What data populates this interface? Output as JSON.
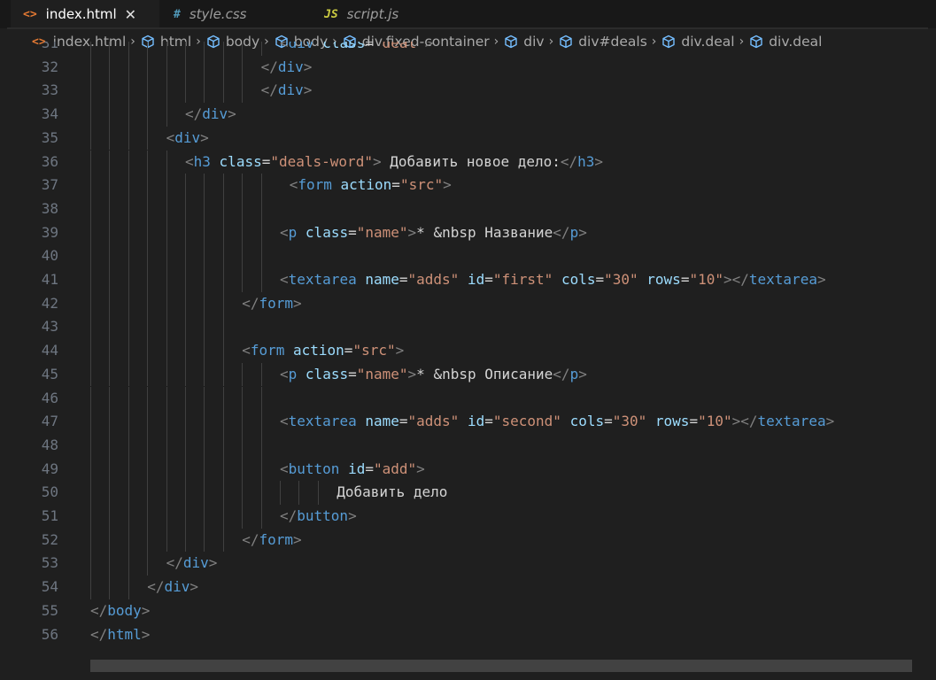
{
  "tabs": [
    {
      "label": "index.html",
      "icon": "<>",
      "active": true
    },
    {
      "label": "style.css",
      "icon": "#",
      "active": false
    },
    {
      "label": "script.js",
      "icon": "JS",
      "active": false
    }
  ],
  "breadcrumb": [
    {
      "label": "index.html",
      "kind": "file"
    },
    {
      "label": "html",
      "kind": "element"
    },
    {
      "label": "body",
      "kind": "element"
    },
    {
      "label": "body",
      "kind": "element"
    },
    {
      "label": "div.fixed-container",
      "kind": "element"
    },
    {
      "label": "div",
      "kind": "element"
    },
    {
      "label": "div#deals",
      "kind": "element"
    },
    {
      "label": "div.deal",
      "kind": "element"
    },
    {
      "label": "div.deal",
      "kind": "element"
    }
  ],
  "code_lines": [
    {
      "n": "31",
      "indent": 10,
      "tokens": [
        [
          "br",
          "<"
        ],
        [
          "tag",
          "div"
        ],
        [
          "text",
          " "
        ],
        [
          "attr",
          "class"
        ],
        [
          "text",
          "="
        ],
        [
          "val",
          "\"deal\""
        ],
        [
          "br",
          ">"
        ]
      ]
    },
    {
      "n": "32",
      "indent": 9,
      "tokens": [
        [
          "br",
          "</"
        ],
        [
          "tag",
          "div"
        ],
        [
          "br",
          ">"
        ]
      ]
    },
    {
      "n": "33",
      "indent": 9,
      "tokens": [
        [
          "br",
          "</"
        ],
        [
          "tag",
          "div"
        ],
        [
          "br",
          ">"
        ]
      ]
    },
    {
      "n": "34",
      "indent": 5,
      "tokens": [
        [
          "br",
          "</"
        ],
        [
          "tag",
          "div"
        ],
        [
          "br",
          ">"
        ]
      ]
    },
    {
      "n": "35",
      "indent": 4,
      "tokens": [
        [
          "br",
          "<"
        ],
        [
          "tag",
          "div"
        ],
        [
          "br",
          ">"
        ]
      ]
    },
    {
      "n": "36",
      "indent": 5,
      "tokens": [
        [
          "br",
          "<"
        ],
        [
          "tag",
          "h3"
        ],
        [
          "text",
          " "
        ],
        [
          "attr",
          "class"
        ],
        [
          "text",
          "="
        ],
        [
          "val",
          "\"deals-word\""
        ],
        [
          "br",
          ">"
        ],
        [
          "text",
          " Добавить новое дело:"
        ],
        [
          "br",
          "</"
        ],
        [
          "tag",
          "h3"
        ],
        [
          "br",
          ">"
        ]
      ]
    },
    {
      "n": "37",
      "indent": 10.5,
      "tokens": [
        [
          "br",
          "<"
        ],
        [
          "tag",
          "form"
        ],
        [
          "text",
          " "
        ],
        [
          "attr",
          "action"
        ],
        [
          "text",
          "="
        ],
        [
          "val",
          "\"src\""
        ],
        [
          "br",
          ">"
        ]
      ]
    },
    {
      "n": "38",
      "indent": 10,
      "tokens": []
    },
    {
      "n": "39",
      "indent": 10,
      "tokens": [
        [
          "br",
          "<"
        ],
        [
          "tag",
          "p"
        ],
        [
          "text",
          " "
        ],
        [
          "attr",
          "class"
        ],
        [
          "text",
          "="
        ],
        [
          "val",
          "\"name\""
        ],
        [
          "br",
          ">"
        ],
        [
          "text",
          "* &nbsp Название"
        ],
        [
          "br",
          "</"
        ],
        [
          "tag",
          "p"
        ],
        [
          "br",
          ">"
        ]
      ]
    },
    {
      "n": "40",
      "indent": 10,
      "tokens": []
    },
    {
      "n": "41",
      "indent": 10,
      "tokens": [
        [
          "br",
          "<"
        ],
        [
          "tag",
          "textarea"
        ],
        [
          "text",
          " "
        ],
        [
          "attr",
          "name"
        ],
        [
          "text",
          "="
        ],
        [
          "val",
          "\"adds\""
        ],
        [
          "text",
          " "
        ],
        [
          "attr",
          "id"
        ],
        [
          "text",
          "="
        ],
        [
          "val",
          "\"first\""
        ],
        [
          "text",
          " "
        ],
        [
          "attr",
          "cols"
        ],
        [
          "text",
          "="
        ],
        [
          "val",
          "\"30\""
        ],
        [
          "text",
          " "
        ],
        [
          "attr",
          "rows"
        ],
        [
          "text",
          "="
        ],
        [
          "val",
          "\"10\""
        ],
        [
          "br",
          "></"
        ],
        [
          "tag",
          "textarea"
        ],
        [
          "br",
          ">"
        ]
      ]
    },
    {
      "n": "42",
      "indent": 8,
      "tokens": [
        [
          "br",
          "</"
        ],
        [
          "tag",
          "form"
        ],
        [
          "br",
          ">"
        ]
      ]
    },
    {
      "n": "43",
      "indent": 8,
      "tokens": []
    },
    {
      "n": "44",
      "indent": 8,
      "tokens": [
        [
          "br",
          "<"
        ],
        [
          "tag",
          "form"
        ],
        [
          "text",
          " "
        ],
        [
          "attr",
          "action"
        ],
        [
          "text",
          "="
        ],
        [
          "val",
          "\"src\""
        ],
        [
          "br",
          ">"
        ]
      ]
    },
    {
      "n": "45",
      "indent": 10,
      "tokens": [
        [
          "br",
          "<"
        ],
        [
          "tag",
          "p"
        ],
        [
          "text",
          " "
        ],
        [
          "attr",
          "class"
        ],
        [
          "text",
          "="
        ],
        [
          "val",
          "\"name\""
        ],
        [
          "br",
          ">"
        ],
        [
          "text",
          "* &nbsp Описание"
        ],
        [
          "br",
          "</"
        ],
        [
          "tag",
          "p"
        ],
        [
          "br",
          ">"
        ]
      ]
    },
    {
      "n": "46",
      "indent": 10,
      "tokens": []
    },
    {
      "n": "47",
      "indent": 10,
      "tokens": [
        [
          "br",
          "<"
        ],
        [
          "tag",
          "textarea"
        ],
        [
          "text",
          " "
        ],
        [
          "attr",
          "name"
        ],
        [
          "text",
          "="
        ],
        [
          "val",
          "\"adds\""
        ],
        [
          "text",
          " "
        ],
        [
          "attr",
          "id"
        ],
        [
          "text",
          "="
        ],
        [
          "val",
          "\"second\""
        ],
        [
          "text",
          " "
        ],
        [
          "attr",
          "cols"
        ],
        [
          "text",
          "="
        ],
        [
          "val",
          "\"30\""
        ],
        [
          "text",
          " "
        ],
        [
          "attr",
          "rows"
        ],
        [
          "text",
          "="
        ],
        [
          "val",
          "\"10\""
        ],
        [
          "br",
          "></"
        ],
        [
          "tag",
          "textarea"
        ],
        [
          "br",
          ">"
        ]
      ]
    },
    {
      "n": "48",
      "indent": 10,
      "tokens": []
    },
    {
      "n": "49",
      "indent": 10,
      "tokens": [
        [
          "br",
          "<"
        ],
        [
          "tag",
          "button"
        ],
        [
          "text",
          " "
        ],
        [
          "attr",
          "id"
        ],
        [
          "text",
          "="
        ],
        [
          "val",
          "\"add\""
        ],
        [
          "br",
          ">"
        ]
      ]
    },
    {
      "n": "50",
      "indent": 13,
      "tokens": [
        [
          "text",
          "Добавить дело"
        ]
      ]
    },
    {
      "n": "51",
      "indent": 10,
      "tokens": [
        [
          "br",
          "</"
        ],
        [
          "tag",
          "button"
        ],
        [
          "br",
          ">"
        ]
      ]
    },
    {
      "n": "52",
      "indent": 8,
      "tokens": [
        [
          "br",
          "</"
        ],
        [
          "tag",
          "form"
        ],
        [
          "br",
          ">"
        ]
      ]
    },
    {
      "n": "53",
      "indent": 4,
      "tokens": [
        [
          "br",
          "</"
        ],
        [
          "tag",
          "div"
        ],
        [
          "br",
          ">"
        ]
      ]
    },
    {
      "n": "54",
      "indent": 3,
      "tokens": [
        [
          "br",
          "</"
        ],
        [
          "tag",
          "div"
        ],
        [
          "br",
          ">"
        ]
      ]
    },
    {
      "n": "55",
      "indent": 0,
      "tokens": [
        [
          "br",
          "</"
        ],
        [
          "tag",
          "body"
        ],
        [
          "br",
          ">"
        ]
      ]
    },
    {
      "n": "56",
      "indent": 0,
      "tokens": [
        [
          "br",
          "</"
        ],
        [
          "tag",
          "html"
        ],
        [
          "br",
          ">"
        ]
      ]
    }
  ],
  "colors": {
    "tag": "#569cd6",
    "bracket": "#808080",
    "attribute": "#9cdcfe",
    "value": "#ce9178",
    "text": "#d4d4d4",
    "line_number": "#6e7681",
    "background": "#1f1f1f"
  }
}
